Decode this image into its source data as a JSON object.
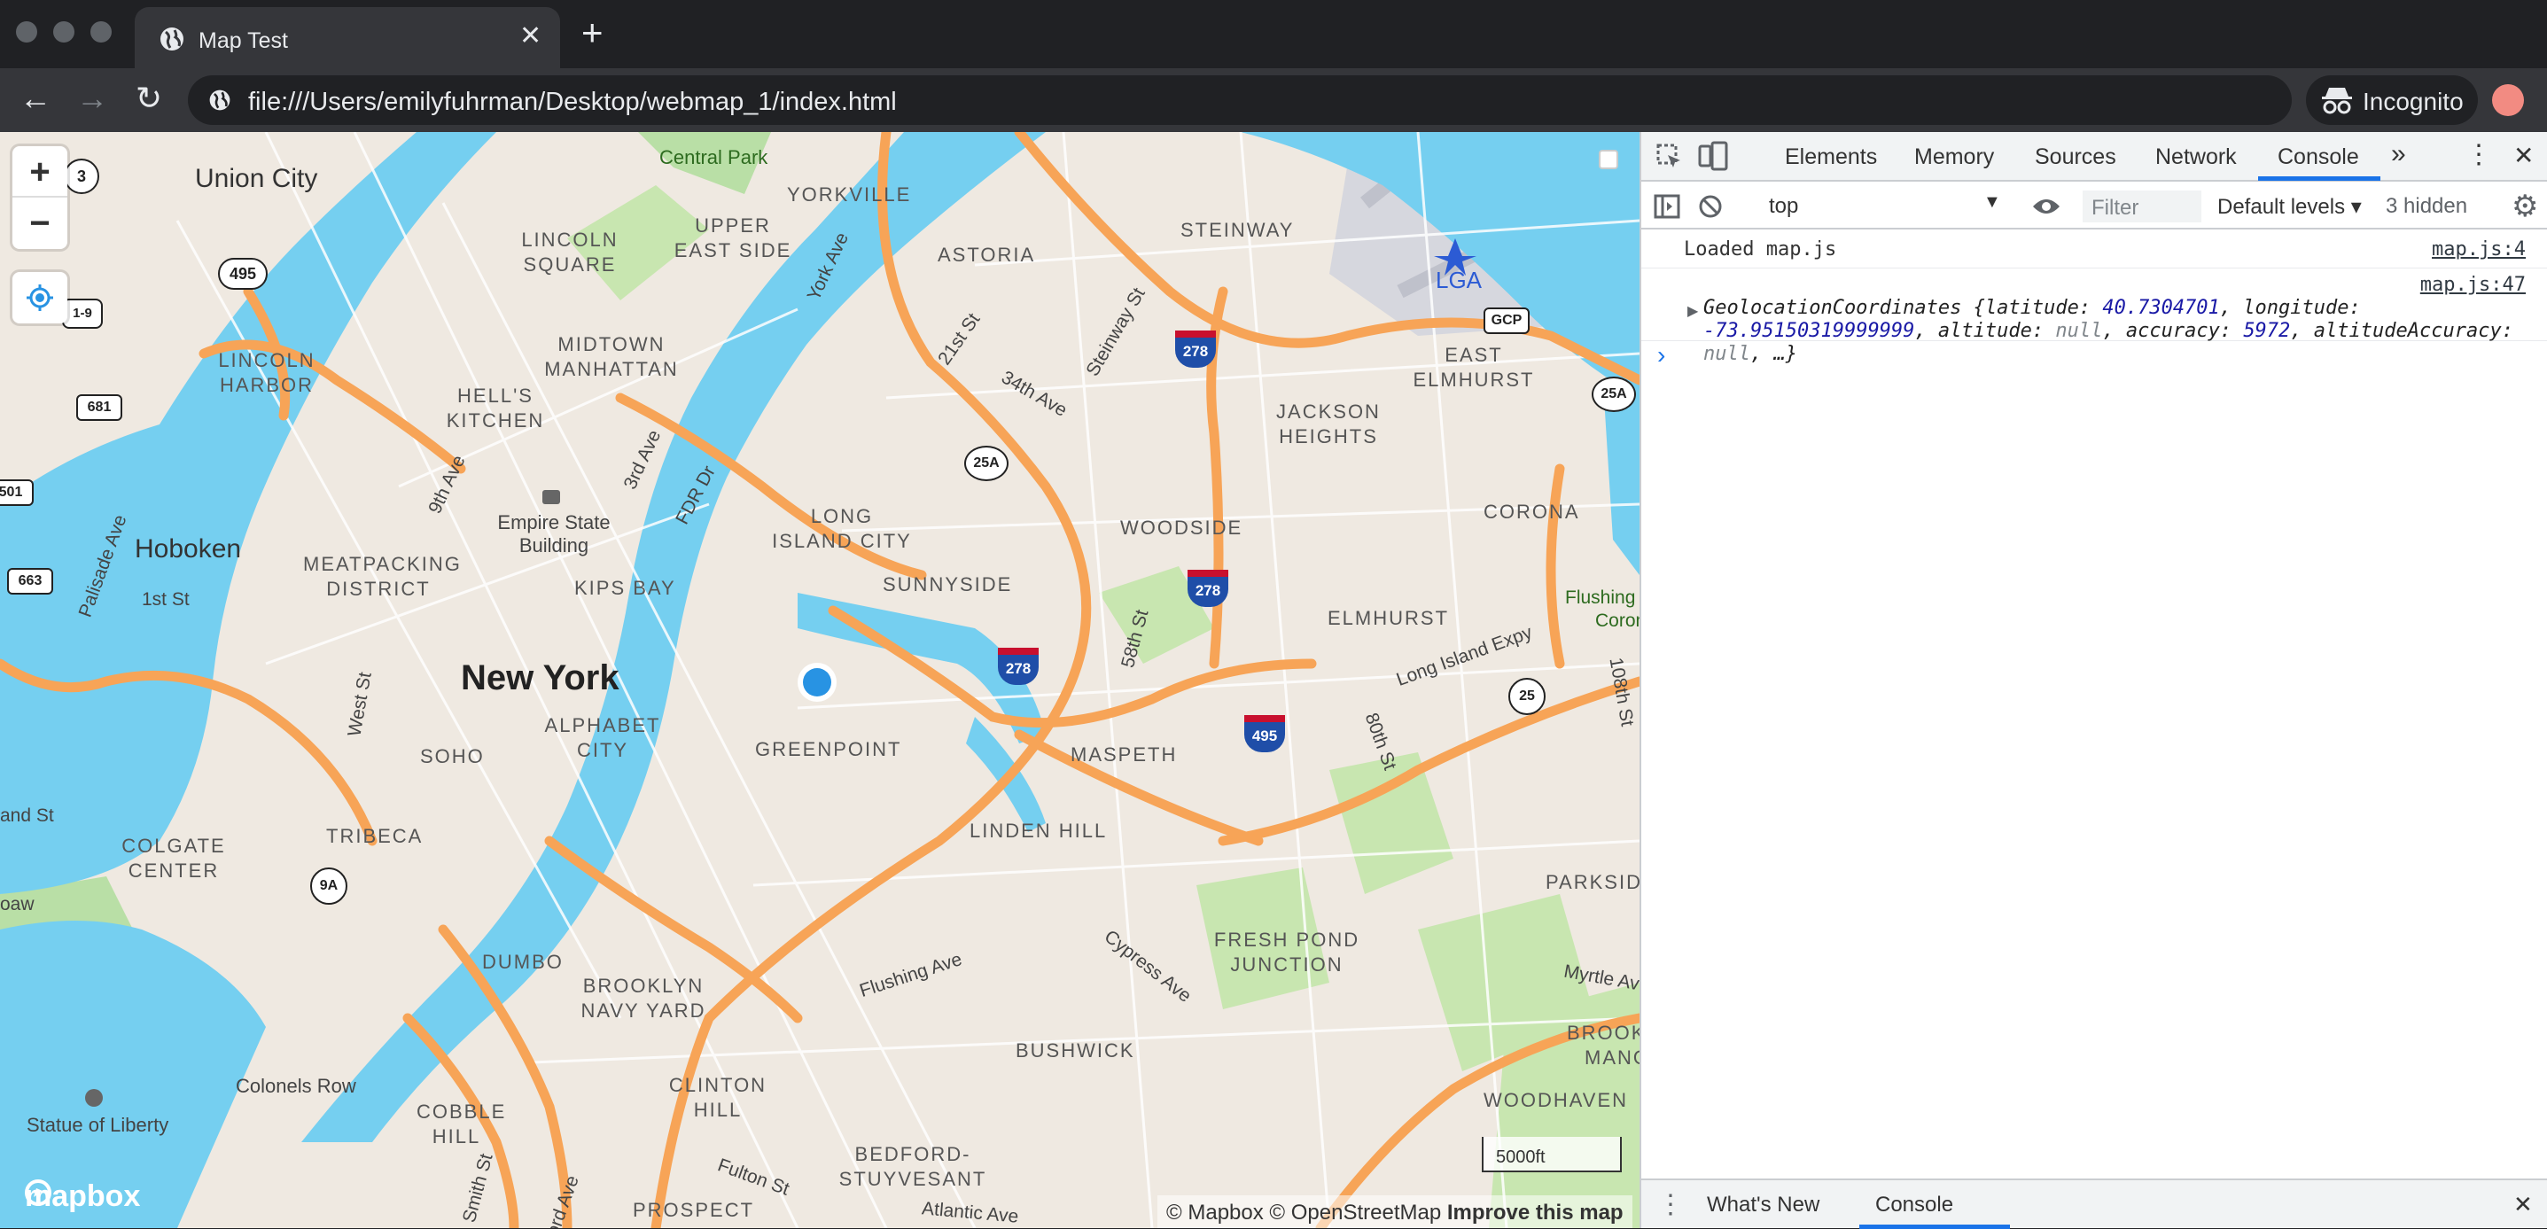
{
  "browser": {
    "tab_title": "Map Test",
    "url": "file:///Users/emilyfuhrman/Desktop/webmap_1/index.html",
    "incognito_label": "Incognito"
  },
  "map": {
    "neighborhoods": [
      "Central Park",
      "YORKVILLE",
      "ASTORIA",
      "STEINWAY",
      "LGA",
      "UPPER EAST SIDE",
      "LINCOLN SQUARE",
      "MIDTOWN MANHATTAN",
      "HELL'S KITCHEN",
      "LINCOLN HARBOR",
      "EAST ELMHURST",
      "JACKSON HEIGHTS",
      "LONG ISLAND CITY",
      "WOODSIDE",
      "CORONA",
      "Empire State Building",
      "KIPS BAY",
      "MEATPACKING DISTRICT",
      "SUNNYSIDE",
      "ELMHURST",
      "Hoboken",
      "New York",
      "ALPHABET CITY",
      "GREENPOINT",
      "MASPETH",
      "SOHO",
      "TRIBECA",
      "COLGATE CENTER",
      "LINDEN HILL",
      "PARKSIDE",
      "FRESH POND JUNCTION",
      "DUMBO",
      "BROOKLYN NAVY YARD",
      "BUSHWICK",
      "Colonels Row",
      "CLINTON HILL",
      "COBBLE HILL",
      "Statue of Liberty",
      "BEDFORD-STUYVESANT",
      "WOODHAVEN",
      "PROSPECT",
      "Union City",
      "Flushing",
      "Corona",
      "BROOK",
      "MANO"
    ],
    "streets": [
      "York Ave",
      "21st St",
      "Steinway St",
      "34th Ave",
      "3rd Ave",
      "9th Ave",
      "FDR Dr",
      "Palisade Ave",
      "1st St",
      "West St",
      "58th St",
      "80th St",
      "Long Island Expy",
      "108th St",
      "Flushing Ave",
      "Cypress Ave",
      "Myrtle Ave",
      "Fulton St",
      "Atlantic Ave",
      "Smith St",
      "and St",
      "oaw",
      "ord Ave"
    ],
    "route_shields": [
      "3",
      "495",
      "1-9",
      "681",
      "501",
      "663",
      "25A",
      "GCP",
      "25A",
      "25",
      "9A"
    ],
    "interstate_shields": [
      "278",
      "278",
      "278",
      "495"
    ],
    "scale_label": "5000ft",
    "attribution": [
      "© Mapbox",
      "© OpenStreetMap",
      "Improve this map"
    ],
    "logo": "mapbox",
    "controls": {
      "zoom_in": "+",
      "zoom_out": "−"
    }
  },
  "devtools": {
    "tabs": [
      "Elements",
      "Memory",
      "Sources",
      "Network",
      "Console"
    ],
    "active_tab": "Console",
    "more_tabs": "»",
    "context": "top",
    "filter_placeholder": "Filter",
    "levels": "Default levels ▾",
    "hidden": "3 hidden",
    "messages": [
      {
        "text": "Loaded map.js",
        "source": "map.js:4"
      },
      {
        "source": "map.js:47",
        "prefix": "GeolocationCoordinates {latitude: ",
        "lat": "40.7304701",
        "mid": ", longitude: ",
        "lon1": "-73.9515031",
        "lon2": "9999999",
        "alt_label": ", altitude: ",
        "alt": "null",
        "acc_label": ", accuracy: ",
        "acc": "5972",
        "altacc_label": ", altitudeAccuracy: ",
        "altacc": "null",
        "tail": ", …}"
      }
    ],
    "prompt": "›",
    "drawer_tabs": [
      "What's New",
      "Console"
    ]
  }
}
